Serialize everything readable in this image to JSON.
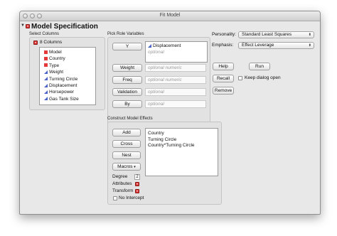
{
  "window": {
    "title": "Fit Model"
  },
  "model_spec": {
    "title": "Model Specification"
  },
  "select_columns": {
    "label": "Select Columns",
    "count_label": "8 Columns",
    "items": [
      {
        "name": "Model",
        "type": "nominal"
      },
      {
        "name": "Country",
        "type": "nominal"
      },
      {
        "name": "Type",
        "type": "nominal"
      },
      {
        "name": "Weight",
        "type": "continuous"
      },
      {
        "name": "Turning Circle",
        "type": "continuous"
      },
      {
        "name": "Displacement",
        "type": "continuous"
      },
      {
        "name": "Horsepower",
        "type": "continuous"
      },
      {
        "name": "Gas Tank Size",
        "type": "continuous"
      }
    ]
  },
  "pick_role": {
    "label": "Pick Role Variables",
    "y_button": "Y",
    "y_value": "Displacement",
    "y_optional": "optional",
    "weight_button": "Weight",
    "weight_placeholder": "optional numeric",
    "freq_button": "Freq",
    "freq_placeholder": "optional numeric",
    "validation_button": "Validation",
    "validation_placeholder": "optional",
    "by_button": "By",
    "by_placeholder": "optional"
  },
  "settings": {
    "personality_label": "Personality:",
    "personality_value": "Standard Least Squares",
    "emphasis_label": "Emphasis:",
    "emphasis_value": "Effect Leverage"
  },
  "actions": {
    "help": "Help",
    "run": "Run",
    "recall": "Recall",
    "keep_dialog_open": "Keep dialog open",
    "remove": "Remove"
  },
  "construct": {
    "label": "Construct Model Effects",
    "add": "Add",
    "cross": "Cross",
    "nest": "Nest",
    "macros": "Macros",
    "degree_label": "Degree",
    "degree_value": "2",
    "attributes_label": "Attributes",
    "transform_label": "Transform",
    "no_intercept": "No Intercept",
    "effects": [
      "Country",
      "Turning Circle",
      "Country*Turning Circle"
    ]
  },
  "colors": {
    "nominal": "#e43a3a",
    "continuous": "#4a63c9",
    "outline_button": "#dd3333"
  }
}
